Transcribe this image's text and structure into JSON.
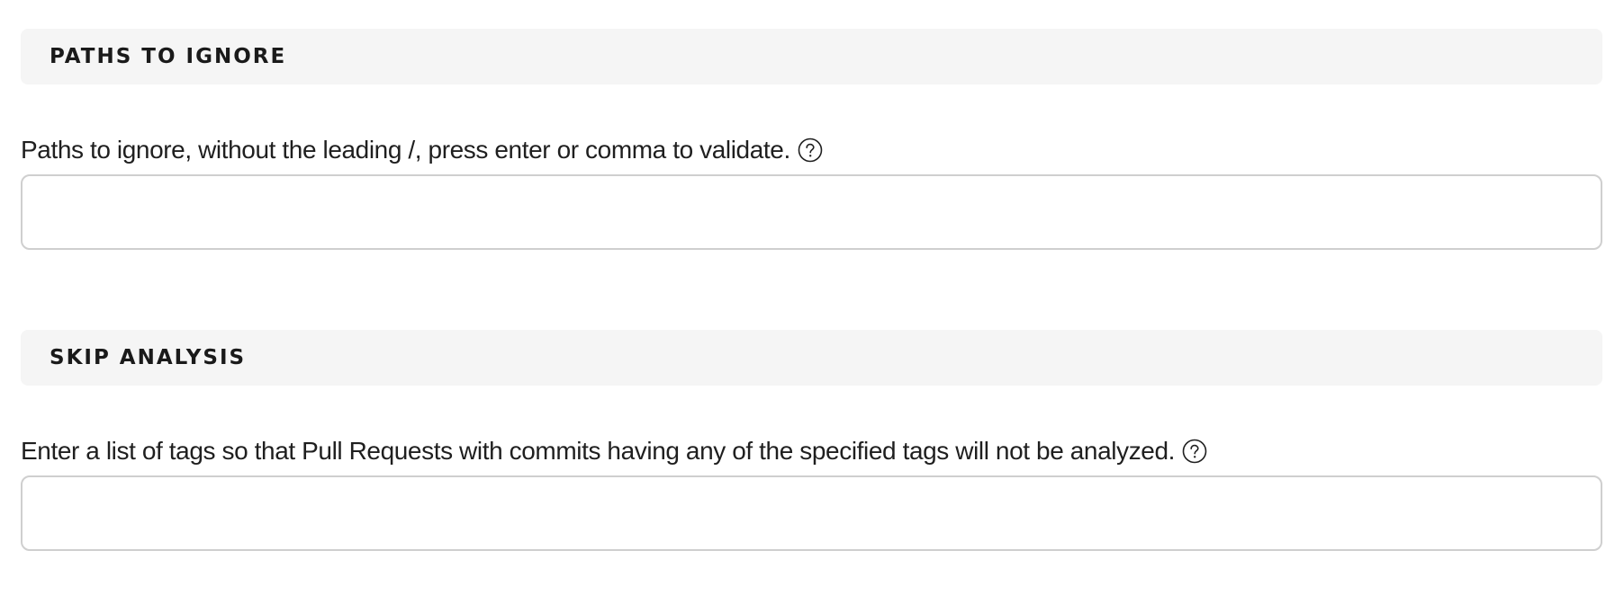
{
  "paths_to_ignore": {
    "title": "PATHS TO IGNORE",
    "label": "Paths to ignore, without the leading /, press enter or comma to validate.",
    "help_icon": "question-circle-icon",
    "input_value": "",
    "input_placeholder": ""
  },
  "skip_analysis": {
    "title": "SKIP ANALYSIS",
    "label": "Enter a list of tags so that Pull Requests with commits having any of the specified tags will not be analyzed.",
    "help_icon": "question-circle-icon",
    "input_value": "",
    "input_placeholder": ""
  },
  "colors": {
    "header_background": "#f5f5f5",
    "input_border": "#cfcfcf",
    "text": "#1f1f1f"
  }
}
